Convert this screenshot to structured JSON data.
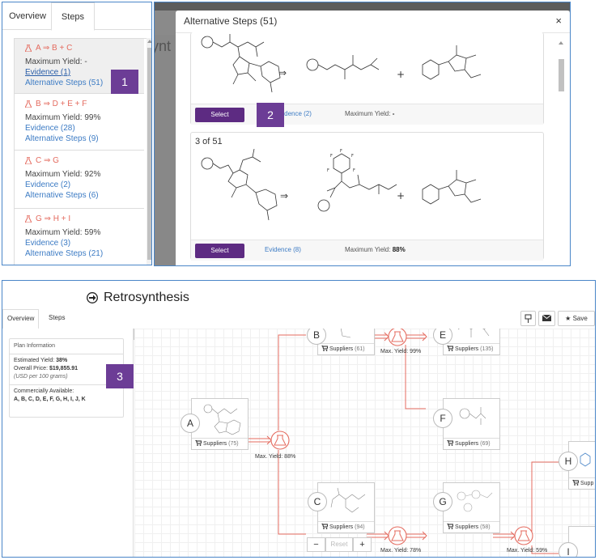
{
  "steps_panel": {
    "tabs": [
      "Overview",
      "Steps"
    ],
    "steps": [
      {
        "reaction": "A ⇒ B + C",
        "yield_text": "Maximum Yield: -",
        "evidence": "Evidence (1)",
        "alt": "Alternative Steps (51)"
      },
      {
        "reaction": "B ⇒ D + E + F",
        "yield_text": "Maximum Yield: 99%",
        "evidence": "Evidence (28)",
        "alt": "Alternative Steps (9)"
      },
      {
        "reaction": "C ⇒ G",
        "yield_text": "Maximum Yield: 92%",
        "evidence": "Evidence (2)",
        "alt": "Alternative Steps (6)"
      },
      {
        "reaction": "G ⇒ H + I",
        "yield_text": "Maximum Yield: 59%",
        "evidence": "Evidence (3)",
        "alt": "Alternative Steps (21)"
      }
    ]
  },
  "badges": [
    "1",
    "2",
    "3"
  ],
  "modal": {
    "title": "Alternative Steps (51)",
    "close": "×",
    "background_text": "ynt",
    "cards": [
      {
        "select": "Select",
        "evidence": "Evidence (2)",
        "yield_label": "Maximum Yield:",
        "yield_value": "-"
      },
      {
        "number": "3 of 51",
        "select": "Select",
        "evidence": "Evidence (8)",
        "yield_label": "Maximum Yield:",
        "yield_value": "88%"
      }
    ],
    "arrow": "⇒",
    "plus": "+"
  },
  "retro": {
    "title": "Retrosynthesis",
    "tabs": [
      "Overview",
      "Steps"
    ],
    "toolbar": {
      "save": "Save"
    },
    "collapse": "‹",
    "plan": {
      "header": "Plan Information",
      "est_label": "Estimated Yield:",
      "est_value": "38%",
      "price_label": "Overall Price:",
      "price_value": "$19,855.91",
      "price_note": "(USD per 100 grams)",
      "avail_label": "Commercially Available:",
      "avail_value": "A, B, C, D, E, F, G, H, I, J, K"
    },
    "nodes": {
      "A": {
        "label": "A",
        "supp": "Suppliers",
        "count": "(75)"
      },
      "B": {
        "label": "B",
        "supp": "Suppliers",
        "count": "(61)"
      },
      "C": {
        "label": "C",
        "supp": "Suppliers",
        "count": "(94)"
      },
      "E": {
        "label": "E",
        "supp": "Suppliers",
        "count": "(135)"
      },
      "F": {
        "label": "F",
        "supp": "Suppliers",
        "count": "(69)"
      },
      "G": {
        "label": "G",
        "supp": "Suppliers",
        "count": "(58)"
      },
      "H": {
        "label": "H",
        "supp": "Supp"
      },
      "I": {
        "label": "I"
      }
    },
    "yields": [
      "Max. Yield: 88%",
      "Max. Yield: 99%",
      "Max. Yield: 78%",
      "Max. Yield: 59%"
    ],
    "zoom": {
      "minus": "−",
      "reset": "Reset",
      "plus": "+"
    }
  },
  "colors": {
    "accent": "#e46b5f",
    "link": "#3c7bc4",
    "button": "#5d2b82",
    "badge": "#6c3d96",
    "frame": "#4a86c8"
  }
}
